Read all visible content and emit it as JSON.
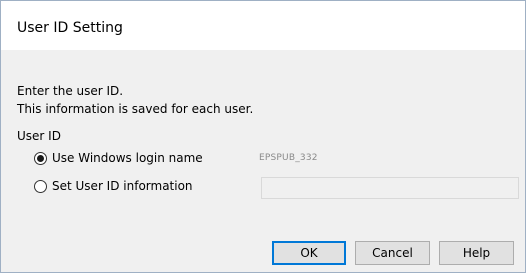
{
  "dialog": {
    "title": "User ID Setting",
    "intro_line1": "Enter the user ID.",
    "intro_line2": "This information is saved for each user.",
    "section_label": "User ID",
    "options": [
      {
        "label": "Use Windows login name",
        "selected": true,
        "value": "EPSPUB_332"
      },
      {
        "label": "Set User ID information",
        "selected": false,
        "value": ""
      }
    ],
    "user_id_input": {
      "value": "",
      "enabled": false
    },
    "buttons": {
      "ok": "OK",
      "cancel": "Cancel",
      "help": "Help"
    }
  }
}
